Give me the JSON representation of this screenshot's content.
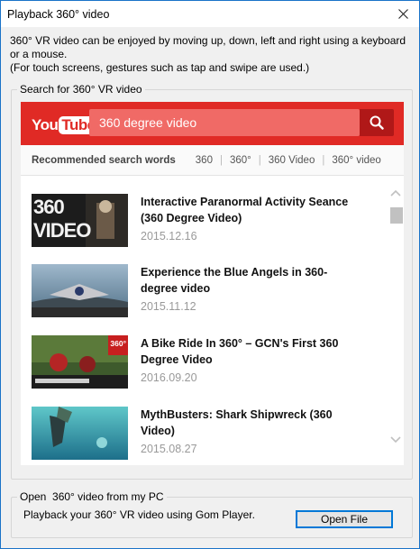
{
  "window": {
    "title": "Playback 360° video",
    "close_icon": "close-icon"
  },
  "description": {
    "line1": "360° VR video can be enjoyed by moving up, down, left and right using a keyboard or a mouse.",
    "line2": "(For touch screens, gestures such as tap and swipe are used.)"
  },
  "search_group": {
    "legend": "Search for 360° VR video",
    "youtube": {
      "logo_you": "You",
      "logo_tube": "Tube",
      "search_value": "360 degree video",
      "search_icon": "search-icon",
      "brand_color": "#e02a25"
    },
    "recommended": {
      "label": "Recommended search words",
      "words": [
        "360",
        "360°",
        "360 Video",
        "360° video"
      ]
    },
    "videos": [
      {
        "title": "Interactive Paranormal Activity Seance (360 Degree Video)",
        "date": "2015.12.16",
        "thumb_text": "360 VIDEO"
      },
      {
        "title": "Experience the Blue Angels in 360-degree video",
        "date": "2015.11.12"
      },
      {
        "title": "A Bike Ride In 360° – GCN's First 360 Degree Video",
        "date": "2016.09.20",
        "thumb_badge": "360°"
      },
      {
        "title": "MythBusters: Shark Shipwreck (360 Video)",
        "date": "2015.08.27"
      }
    ]
  },
  "open_group": {
    "legend": "Open  360° video from my PC",
    "description": "Playback your 360° VR video using Gom Player.",
    "button_label": "Open File"
  }
}
